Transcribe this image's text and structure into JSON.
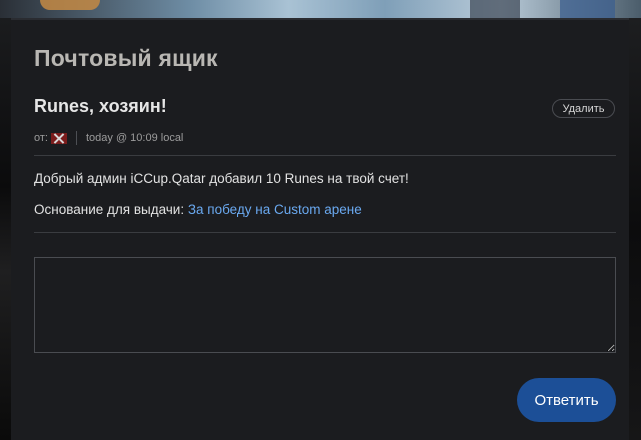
{
  "mailbox": {
    "title": "Почтовый ящик"
  },
  "message": {
    "subject": "Runes, хозяин!",
    "delete_label": "Удалить",
    "from_label": "от:",
    "sender_avatar_icon": "flag-x-icon",
    "timestamp": "today @ 10:09 local",
    "body_line": "Добрый админ iCCup.Qatar добавил 10 Runes на твой счет!",
    "reason_label": "Основание для выдачи:",
    "reason_link": "За победу на Custom арене"
  },
  "reply": {
    "input_value": "",
    "button_label": "Ответить"
  },
  "colors": {
    "panel_bg": "#1b1c1f",
    "link": "#6aa9f0",
    "reply_button": "#1c4f97",
    "title": "#b9b7b3"
  }
}
